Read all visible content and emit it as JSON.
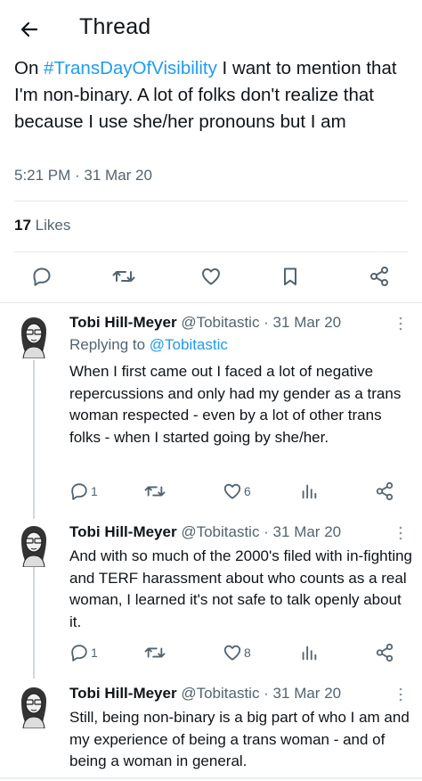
{
  "header": {
    "title": "Thread"
  },
  "tweet": {
    "text_before": "On ",
    "hashtag": "#TransDayOfVisibility",
    "text_after": " I want to mention that I'm non-binary. A lot of folks don't realize that because I use she/her pronouns but I am",
    "timestamp": "5:21 PM · 31 Mar 20",
    "likes_count": "17",
    "likes_label": "Likes"
  },
  "replies": [
    {
      "name": "Tobi Hill-Meyer",
      "handle_date": "@Tobitastic · 31 Mar 20",
      "replying_prefix": "Replying to ",
      "replying_to": "@Tobitastic",
      "text": "When I first came out I faced a lot of negative repercussions and only had my gender as a trans woman respected - even by a lot of other trans folks - when I started going by she/her.",
      "reply_count": "1",
      "like_count": "6"
    },
    {
      "name": "Tobi Hill-Meyer",
      "handle_date": "@Tobitastic · 31 Mar 20",
      "text": "And with so much of the 2000's filed with in-fighting and TERF harassment about who counts as a real woman, I learned it's not safe to talk openly about it.",
      "reply_count": "1",
      "like_count": "8"
    },
    {
      "name": "Tobi Hill-Meyer",
      "handle_date": "@Tobitastic · 31 Mar 20",
      "text": "Still, being non-binary is a big part of who I am and my experience of being a trans woman - and of being a woman in general."
    }
  ],
  "icons": {
    "back": "arrow-left-icon",
    "reply": "speech-bubble-icon",
    "retweet": "retweet-icon",
    "like": "heart-icon",
    "bookmark": "bookmark-icon",
    "share": "share-icon",
    "views": "bar-chart-icon",
    "more": "more-vertical-icon"
  },
  "colors": {
    "accent": "#1d9bf0",
    "secondary_text": "#536471",
    "text": "#0f1419",
    "divider": "#e6e9eb"
  }
}
